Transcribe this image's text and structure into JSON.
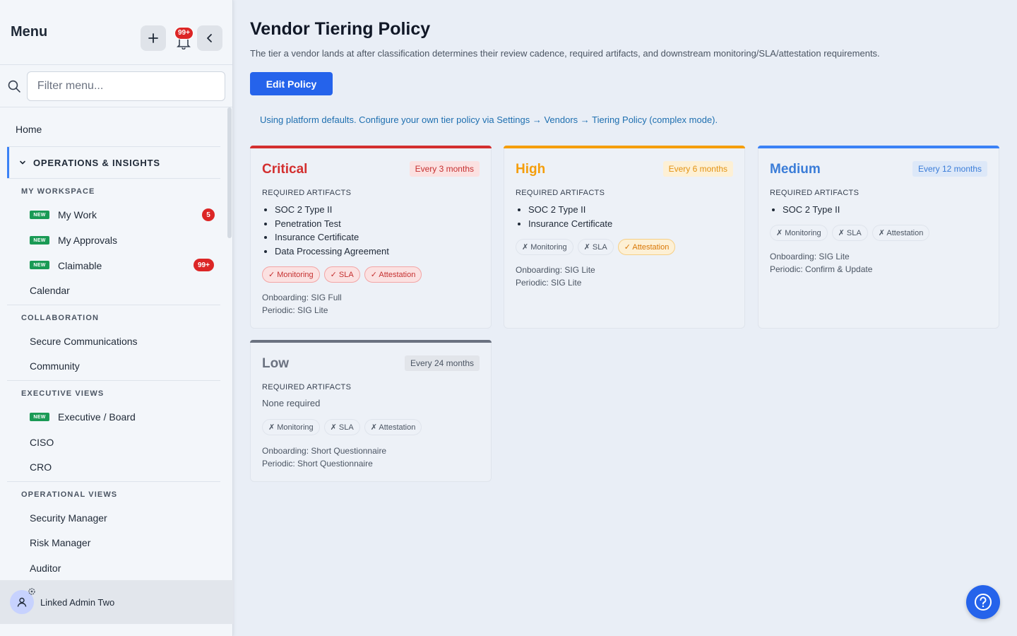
{
  "sidebar": {
    "title": "Menu",
    "notification_count": "99+",
    "search_placeholder": "Filter menu...",
    "home": "Home",
    "group": "OPERATIONS & INSIGHTS",
    "new_label": "NEW",
    "sections": [
      {
        "title": "MY WORKSPACE",
        "items": [
          {
            "label": "My Work",
            "new": true,
            "badge": "5"
          },
          {
            "label": "My Approvals",
            "new": true
          },
          {
            "label": "Claimable",
            "new": true,
            "badge": "99+"
          },
          {
            "label": "Calendar"
          }
        ]
      },
      {
        "title": "COLLABORATION",
        "items": [
          {
            "label": "Secure Communications"
          },
          {
            "label": "Community"
          }
        ]
      },
      {
        "title": "EXECUTIVE VIEWS",
        "items": [
          {
            "label": "Executive / Board",
            "new": true
          },
          {
            "label": "CISO"
          },
          {
            "label": "CRO"
          }
        ]
      },
      {
        "title": "OPERATIONAL VIEWS",
        "items": [
          {
            "label": "Security Manager"
          },
          {
            "label": "Risk Manager"
          },
          {
            "label": "Auditor"
          }
        ]
      }
    ],
    "user_name": "Linked Admin Two"
  },
  "main": {
    "title": "Vendor Tiering Policy",
    "description": "The tier a vendor lands at after classification determines their review cadence, required artifacts, and downstream monitoring/SLA/attestation requirements.",
    "edit_button": "Edit Policy",
    "info_note": "Using platform defaults. Configure your own tier policy via Settings → Vendors → Tiering Policy (complex mode).",
    "required_label": "REQUIRED ARTIFACTS",
    "tiers": [
      {
        "name": "Critical",
        "cadence": "Every 3 months",
        "color": "#d32f2f",
        "artifacts": [
          "SOC 2 Type II",
          "Penetration Test",
          "Insurance Certificate",
          "Data Processing Agreement"
        ],
        "chips": [
          "✓ Monitoring",
          "✓ SLA",
          "✓ Attestation"
        ],
        "onboarding": "Onboarding: SIG Full",
        "periodic": "Periodic: SIG Lite"
      },
      {
        "name": "High",
        "cadence": "Every 6 months",
        "color": "#f59e0b",
        "artifacts": [
          "SOC 2 Type II",
          "Insurance Certificate"
        ],
        "chips": [
          "✗ Monitoring",
          "✗ SLA",
          "✓ Attestation"
        ],
        "onboarding": "Onboarding: SIG Lite",
        "periodic": "Periodic: SIG Lite"
      },
      {
        "name": "Medium",
        "cadence": "Every 12 months",
        "color": "#3b82f6",
        "artifacts": [
          "SOC 2 Type II"
        ],
        "chips": [
          "✗ Monitoring",
          "✗ SLA",
          "✗ Attestation"
        ],
        "onboarding": "Onboarding: SIG Lite",
        "periodic": "Periodic: Confirm & Update"
      },
      {
        "name": "Low",
        "cadence": "Every 24 months",
        "color": "#6b7280",
        "none_required": "None required",
        "chips": [
          "✗ Monitoring",
          "✗ SLA",
          "✗ Attestation"
        ],
        "onboarding": "Onboarding: Short Questionnaire",
        "periodic": "Periodic: Short Questionnaire"
      }
    ]
  },
  "icons": {
    "add": "plus-icon",
    "bell": "bell-icon",
    "collapse": "chevron-left-icon",
    "search": "search-icon",
    "group_toggle": "chevron-down-icon",
    "avatar": "user-icon",
    "help": "question-icon"
  }
}
